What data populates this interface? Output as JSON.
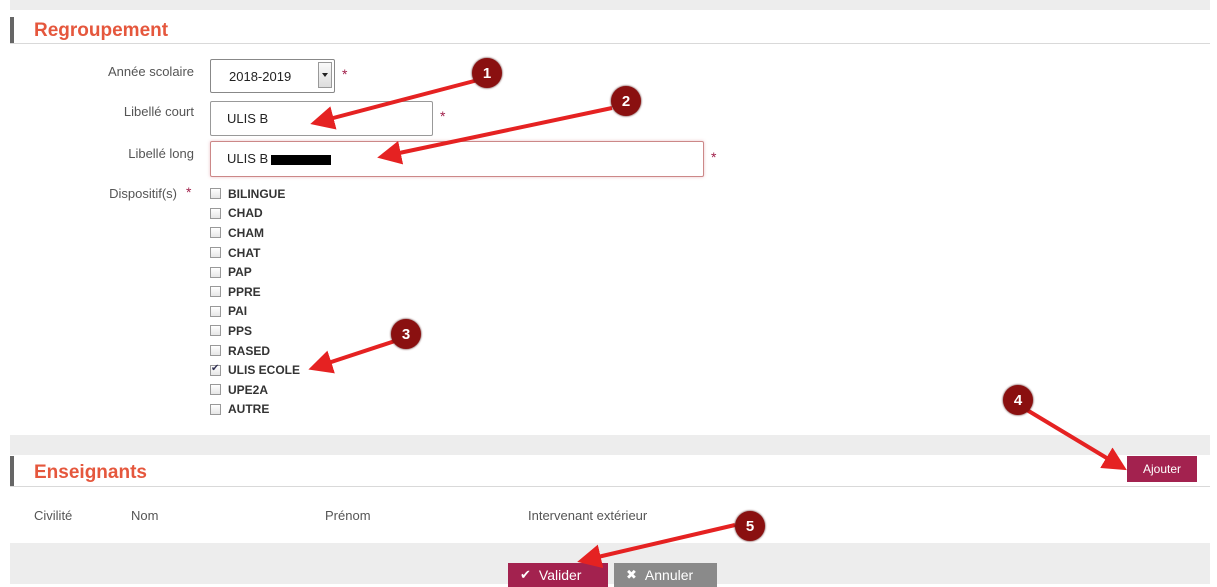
{
  "regroupement": {
    "title": "Regroupement",
    "annee_label": "Année scolaire",
    "annee_value": "2018-2019",
    "libelle_court_label": "Libellé court",
    "libelle_court_value": "ULIS B",
    "libelle_long_label": "Libellé long",
    "libelle_long_value": "ULIS B",
    "dispositifs_label": "Dispositif(s)",
    "required_mark": "*",
    "dispositifs": [
      {
        "label": "BILINGUE",
        "checked": false
      },
      {
        "label": "CHAD",
        "checked": false
      },
      {
        "label": "CHAM",
        "checked": false
      },
      {
        "label": "CHAT",
        "checked": false
      },
      {
        "label": "PAP",
        "checked": false
      },
      {
        "label": "PPRE",
        "checked": false
      },
      {
        "label": "PAI",
        "checked": false
      },
      {
        "label": "PPS",
        "checked": false
      },
      {
        "label": "RASED",
        "checked": false
      },
      {
        "label": "ULIS ECOLE",
        "checked": true
      },
      {
        "label": "UPE2A",
        "checked": false
      },
      {
        "label": "AUTRE",
        "checked": false
      }
    ]
  },
  "enseignants": {
    "title": "Enseignants",
    "add_label": "Ajouter",
    "columns": [
      "Civilité",
      "Nom",
      "Prénom",
      "Intervenant extérieur"
    ]
  },
  "footer": {
    "valider_label": "Valider",
    "annuler_label": "Annuler"
  },
  "callouts": [
    "1",
    "2",
    "3",
    "4",
    "5"
  ],
  "colors": {
    "accent": "#a3224f",
    "section_title": "#e5573d",
    "callout": "#8a1010",
    "arrow": "#e52222"
  }
}
